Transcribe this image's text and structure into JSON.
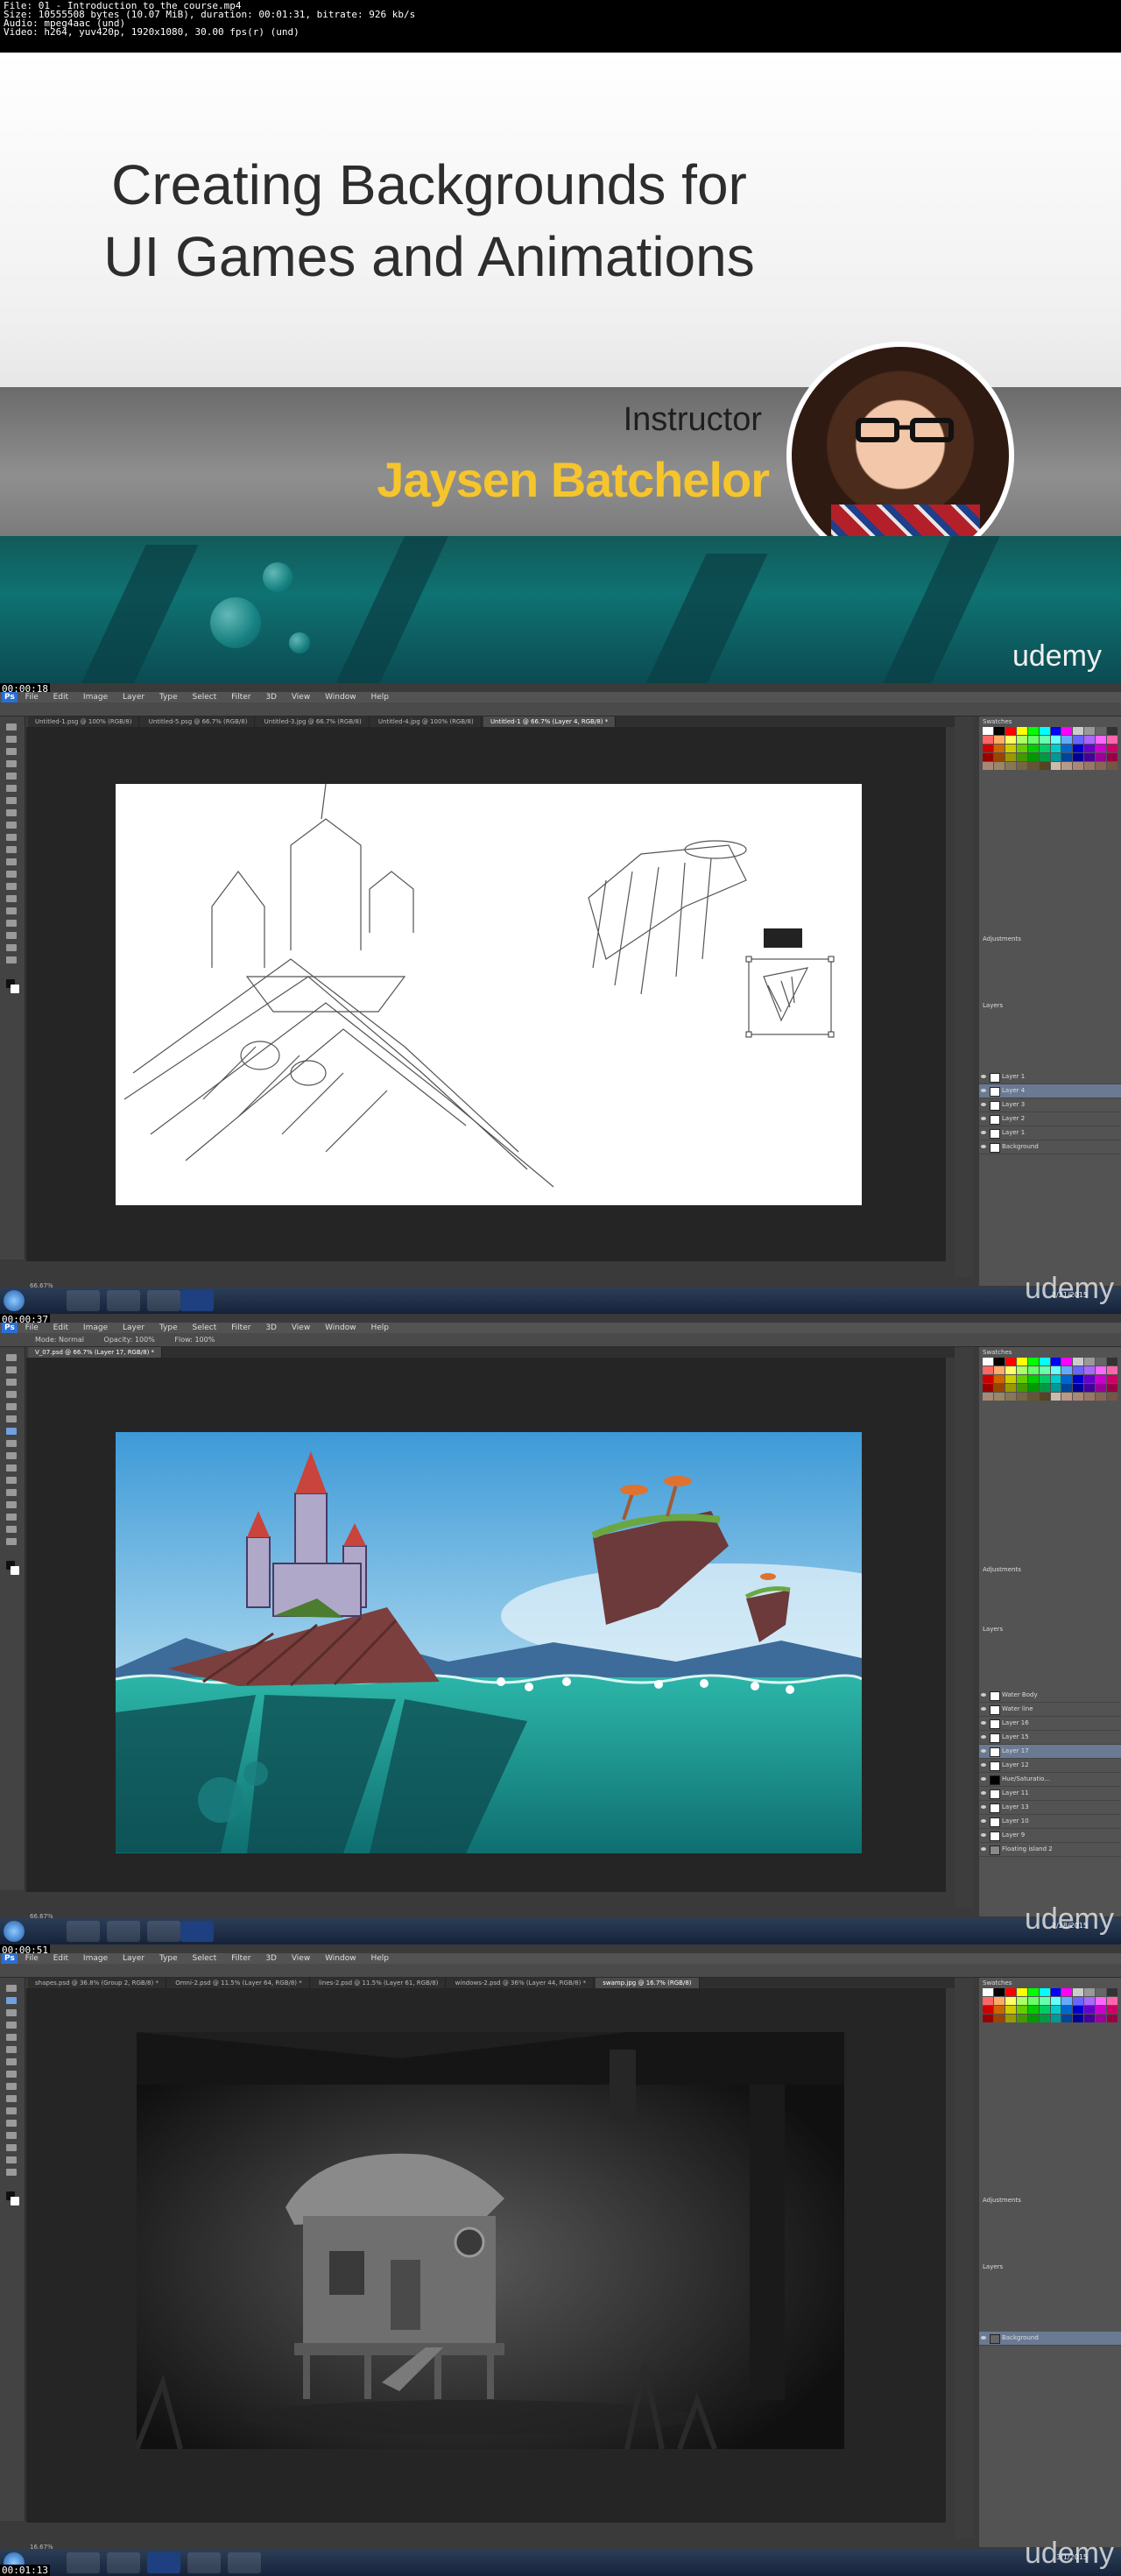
{
  "file_info": {
    "line1": "File: 01 - Introduction to the course.mp4",
    "line2": "Size: 10555508 bytes (10.07 MiB), duration: 00:01:31, bitrate: 926 kb/s",
    "line3": "Audio: mpeg4aac (und)",
    "line4": "Video: h264, yuv420p, 1920x1080, 30.00 fps(r) (und)"
  },
  "slide": {
    "title_line1": "Creating Backgrounds for",
    "title_line2": "UI Games and Animations",
    "instructor_label": "Instructor",
    "instructor_name": "Jaysen Batchelor",
    "brand": "udemy"
  },
  "frames": [
    {
      "timestamp": "00:00:18",
      "menu": [
        "File",
        "Edit",
        "Image",
        "Layer",
        "Type",
        "Select",
        "Filter",
        "3D",
        "View",
        "Window",
        "Help"
      ],
      "tabs": [
        "Untitled-1.psg @ 100% (RGB/8)",
        "Untitled-5.psg @ 66.7% (RGB/8)",
        "Untitled-3.jpg @ 66.7% (RGB/8)",
        "Untitled-4.jpg @ 100% (RGB/8)",
        "Untitled-1 @ 66.7% (Layer 4, RGB/8) *"
      ],
      "layers": [
        "Layer 1",
        "Layer 4",
        "Layer 3",
        "Layer 2",
        "Layer 1",
        "Background"
      ],
      "status": "66.67%",
      "clock_time": "",
      "clock_date": "2/21/2015",
      "watermark": "udemy"
    },
    {
      "timestamp": "00:00:37",
      "menu": [
        "File",
        "Edit",
        "Image",
        "Layer",
        "Type",
        "Select",
        "Filter",
        "3D",
        "View",
        "Window",
        "Help"
      ],
      "tabs": [
        "V_07.psd @ 66.7% (Layer 17, RGB/8) *"
      ],
      "options": [
        "Mode: Normal",
        "Opacity: 100%",
        "Flow: 100%"
      ],
      "layers": [
        "Water Body",
        "Water line",
        "Layer 16",
        "Layer 15",
        "Layer 17",
        "Layer 12",
        "Hue/Saturatio...",
        "Layer 11",
        "Layer 13",
        "Layer 10",
        "Layer 9",
        "Floating island 2"
      ],
      "status": "66.67%",
      "clock_date": "2/28/2015",
      "watermark": "udemy"
    },
    {
      "timestamp": "00:00:51",
      "menu": [
        "File",
        "Edit",
        "Image",
        "Layer",
        "Type",
        "Select",
        "Filter",
        "3D",
        "View",
        "Window",
        "Help"
      ],
      "tabs": [
        "shapes.psd @ 36.8% (Group 2, RGB/8) *",
        "Omni-2.psd @ 11.5% (Layer 64, RGB/8) *",
        "lines-2.psd @ 11.5% (Layer 61, RGB/8)",
        "windows-2.psd @ 36% (Layer 44, RGB/8) *",
        "swamp.jpg @ 16.7% (RGB/8)"
      ],
      "layers": [
        "Background"
      ],
      "status": "16.67%",
      "clock_date": "3/1/2015",
      "watermark": "udemy"
    }
  ],
  "final_timestamp": "00:01:13"
}
